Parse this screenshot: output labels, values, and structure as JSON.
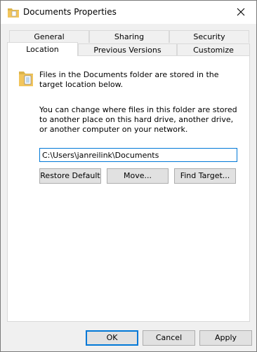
{
  "window": {
    "title": "Documents Properties"
  },
  "tabs_row1": [
    {
      "label": "General"
    },
    {
      "label": "Sharing"
    },
    {
      "label": "Security"
    }
  ],
  "tabs_row2": [
    {
      "label": "Location",
      "active": true
    },
    {
      "label": "Previous Versions"
    },
    {
      "label": "Customize"
    }
  ],
  "location": {
    "info_text": "Files in the Documents folder are stored in the target location below.",
    "change_text": "You can change where files in this folder are stored to another place on this hard drive, another drive, or another computer on your network.",
    "path_value": "C:\\Users\\janreilink\\Documents",
    "restore_label": "Restore Default",
    "move_label": "Move...",
    "find_target_label": "Find Target..."
  },
  "footer": {
    "ok_label": "OK",
    "cancel_label": "Cancel",
    "apply_label": "Apply"
  },
  "colors": {
    "accent": "#0078d7",
    "folder": "#f2c55c"
  }
}
